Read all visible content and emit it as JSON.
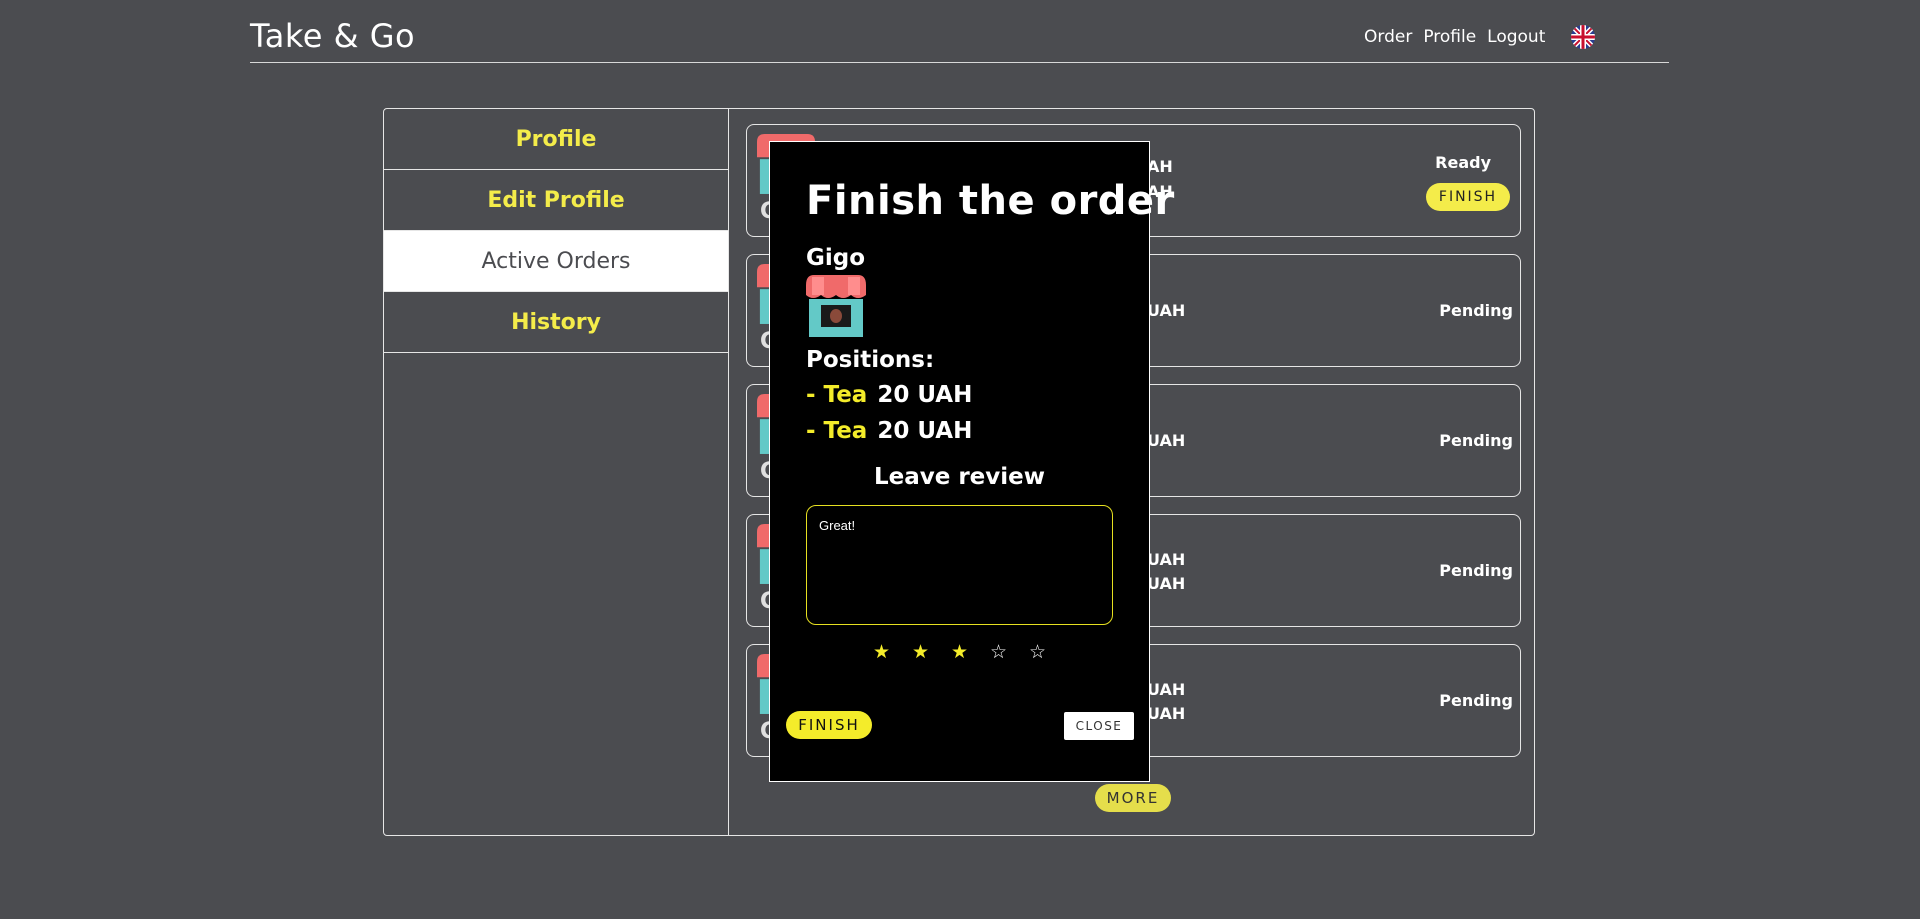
{
  "header": {
    "brand": "Take & Go",
    "nav": [
      "Order",
      "Profile",
      "Logout"
    ],
    "language_icon": "uk-flag-icon"
  },
  "sidebar": {
    "items": [
      {
        "label": "Profile",
        "active": false
      },
      {
        "label": "Edit Profile",
        "active": false
      },
      {
        "label": "Active Orders",
        "active": true
      },
      {
        "label": "History",
        "active": false
      }
    ]
  },
  "orders": [
    {
      "shop_letter": "G",
      "lines": [
        "AH",
        "AH"
      ],
      "status": "Ready",
      "action": "FINISH"
    },
    {
      "shop_letter": "G",
      "lines": [
        "UAH"
      ],
      "status": "Pending"
    },
    {
      "shop_letter": "G",
      "lines": [
        "UAH"
      ],
      "status": "Pending"
    },
    {
      "shop_letter": "G",
      "lines": [
        "UAH",
        "UAH"
      ],
      "status": "Pending"
    },
    {
      "shop_letter": "G",
      "lines": [
        "UAH",
        "UAH"
      ],
      "status": "Pending"
    }
  ],
  "more_label": "MORE",
  "modal": {
    "title": "Finish the order",
    "shop_name": "Gigo",
    "positions_label": "Positions:",
    "positions": [
      {
        "name": "- Tea",
        "price": "20 UAH"
      },
      {
        "name": "- Tea",
        "price": "20 UAH"
      }
    ],
    "review_label": "Leave review",
    "review_text": "Great!",
    "rating": 3,
    "rating_max": 5,
    "finish_label": "FINISH",
    "close_label": "CLOSE"
  },
  "colors": {
    "background": "#4b4c50",
    "accent": "#f4ec4a",
    "modal_bg": "#000000"
  }
}
